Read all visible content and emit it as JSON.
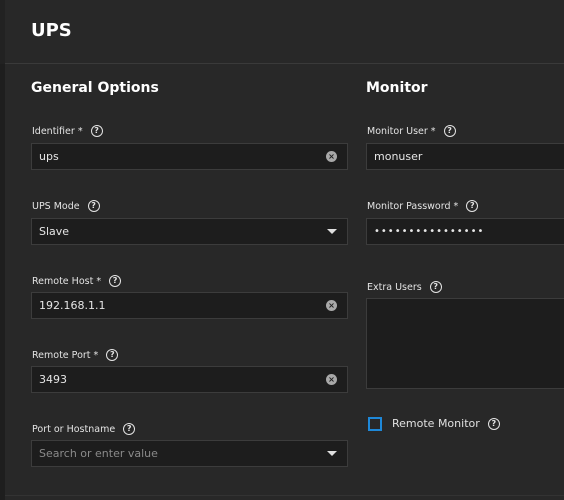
{
  "page": {
    "title": "UPS"
  },
  "general": {
    "title": "General Options",
    "identifier": {
      "label": "Identifier *",
      "value": "ups"
    },
    "ups_mode": {
      "label": "UPS Mode",
      "value": "Slave"
    },
    "remote_host": {
      "label": "Remote Host *",
      "value": "192.168.1.1"
    },
    "remote_port": {
      "label": "Remote Port *",
      "value": "3493"
    },
    "port_or_hostname": {
      "label": "Port or Hostname",
      "placeholder": "Search or enter value"
    }
  },
  "monitor": {
    "title": "Monitor",
    "user": {
      "label": "Monitor User *",
      "value": "monuser"
    },
    "password": {
      "label": "Monitor Password *",
      "value": "••••••••••••••••"
    },
    "extra_users": {
      "label": "Extra Users",
      "value": ""
    },
    "remote_monitor": {
      "label": "Remote Monitor",
      "checked": false
    }
  },
  "icons": {
    "help": "?",
    "clear": "×"
  },
  "colors": {
    "accent": "#1e88d8",
    "background": "#1e1e1e",
    "card": "#282828",
    "input": "#1d1d1d"
  }
}
